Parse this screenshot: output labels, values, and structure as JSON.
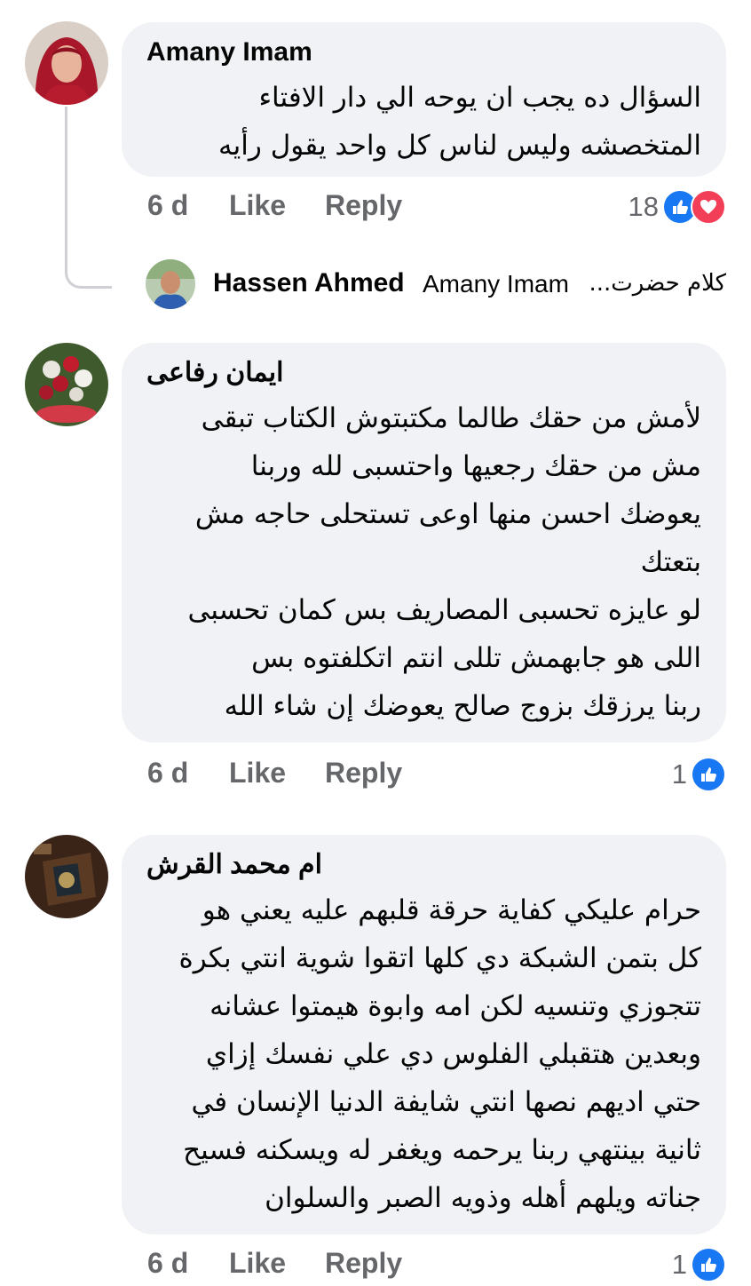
{
  "comments": [
    {
      "author": "Amany Imam",
      "lines": [
        "السؤال ده يجب ان يوحه الي دار الافتاء",
        "المتخصشه وليس لناس كل واحد يقول رأيه"
      ],
      "time": "6 d",
      "like": "Like",
      "reply": "Reply",
      "reaction_count": "18",
      "reactions": [
        "like-icon",
        "love-icon"
      ]
    },
    {
      "author": "ايمان رفاعى",
      "lines": [
        "لأمش من حقك طالما مكتبتوش الكتاب تبقى",
        "مش من حقك رجعيها واحتسبى لله وربنا",
        "يعوضك احسن منها اوعى تستحلى حاجه مش",
        "بتعتك",
        "لو عايزه تحسبى المصاريف بس كمان تحسبى",
        "اللى هو جابهمش تللى انتم اتكلفتوه بس",
        "ربنا يرزقك بزوج صالح يعوضك إن شاء الله"
      ],
      "time": "6 d",
      "like": "Like",
      "reply": "Reply",
      "reaction_count": "1",
      "reactions": [
        "like-icon"
      ]
    },
    {
      "author": "ام محمد القرش",
      "lines": [
        "حرام عليكي كفاية حرقة قلبهم عليه يعني هو",
        "كل بتمن الشبكة دي كلها اتقوا شوية انتي بكرة",
        "تتجوزي وتنسيه لكن امه وابوة هيمتوا عشانه",
        "وبعدين هتقبلي الفلوس دي علي نفسك إزاي",
        "حتي اديهم نصها انتي شايفة الدنيا الإنسان في",
        "ثانية بينتهي ربنا يرحمه ويغفر له ويسكنه فسيح",
        "جناته ويلهم أهله وذويه الصبر والسلوان"
      ],
      "time": "6 d",
      "like": "Like",
      "reply": "Reply",
      "reaction_count": "1",
      "reactions": [
        "like-icon"
      ]
    }
  ],
  "reply_preview": {
    "author": "Hassen Ahmed",
    "mention": "Amany Imam",
    "snippet": "كلام حضرت..."
  },
  "colors": {
    "like": "#1877f2",
    "love": "#f33e58",
    "bubble": "#f0f2f5",
    "meta": "#65676b"
  }
}
